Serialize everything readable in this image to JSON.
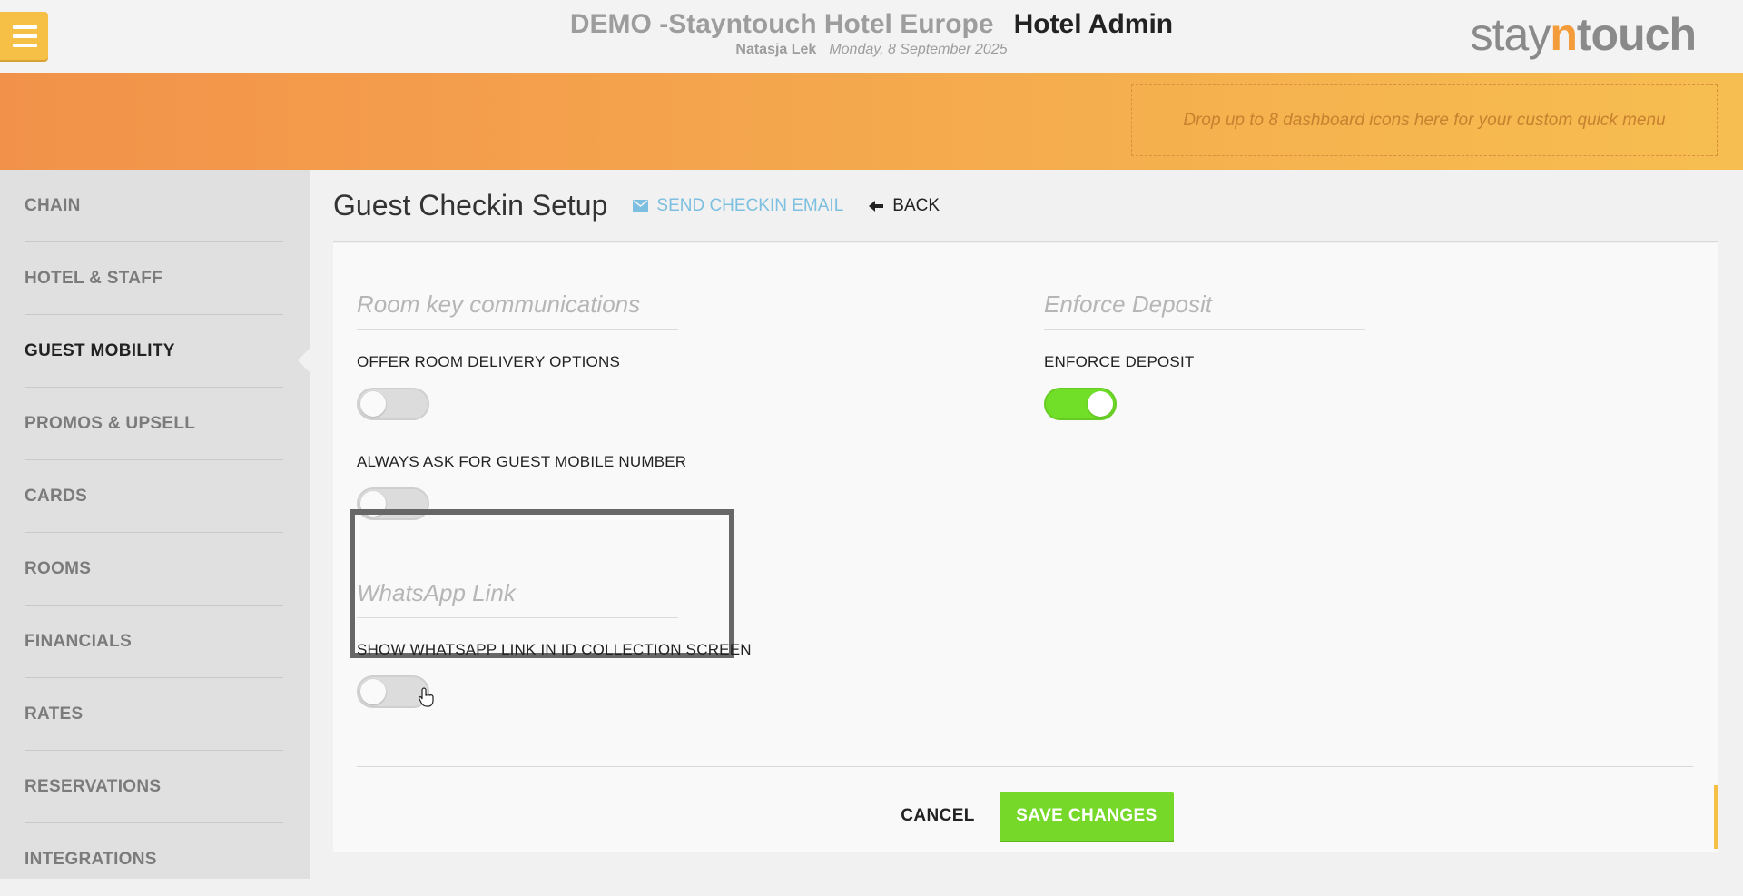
{
  "header": {
    "hotel_name": "DEMO -Stayntouch Hotel Europe",
    "app_name": "Hotel Admin",
    "user": "Natasja Lek",
    "date": "Monday, 8 September 2025",
    "logo": {
      "part1": "stay",
      "part2": "n",
      "part3": "touch"
    },
    "menu_icon": "hamburger-icon"
  },
  "quick_menu": {
    "placeholder": "Drop up to 8 dashboard icons here for your custom quick menu"
  },
  "sidebar": {
    "items": [
      {
        "label": "CHAIN"
      },
      {
        "label": "HOTEL & STAFF"
      },
      {
        "label": "GUEST MOBILITY",
        "active": true
      },
      {
        "label": "PROMOS & UPSELL"
      },
      {
        "label": "CARDS"
      },
      {
        "label": "ROOMS"
      },
      {
        "label": "FINANCIALS"
      },
      {
        "label": "RATES"
      },
      {
        "label": "RESERVATIONS"
      },
      {
        "label": "INTEGRATIONS"
      }
    ]
  },
  "page": {
    "title": "Guest Checkin Setup",
    "send_email_label": "SEND CHECKIN EMAIL",
    "back_label": "BACK"
  },
  "sections": {
    "room_key": {
      "title": "Room key communications",
      "fields": [
        {
          "label": "OFFER ROOM DELIVERY OPTIONS",
          "enabled": false
        },
        {
          "label": "ALWAYS ASK FOR GUEST MOBILE NUMBER",
          "enabled": false
        }
      ]
    },
    "deposit": {
      "title": "Enforce Deposit",
      "fields": [
        {
          "label": "ENFORCE DEPOSIT",
          "enabled": true
        }
      ]
    },
    "whatsapp": {
      "title": "WhatsApp Link",
      "fields": [
        {
          "label": "SHOW WHATSAPP LINK IN ID COLLECTION SCREEN",
          "enabled": false
        }
      ]
    }
  },
  "actions": {
    "cancel_label": "CANCEL",
    "save_label": "SAVE CHANGES"
  },
  "colors": {
    "accent_orange": "#f39c39",
    "toggle_on": "#71df28",
    "save_green": "#76d92a",
    "link_blue": "#7cbfe0"
  }
}
